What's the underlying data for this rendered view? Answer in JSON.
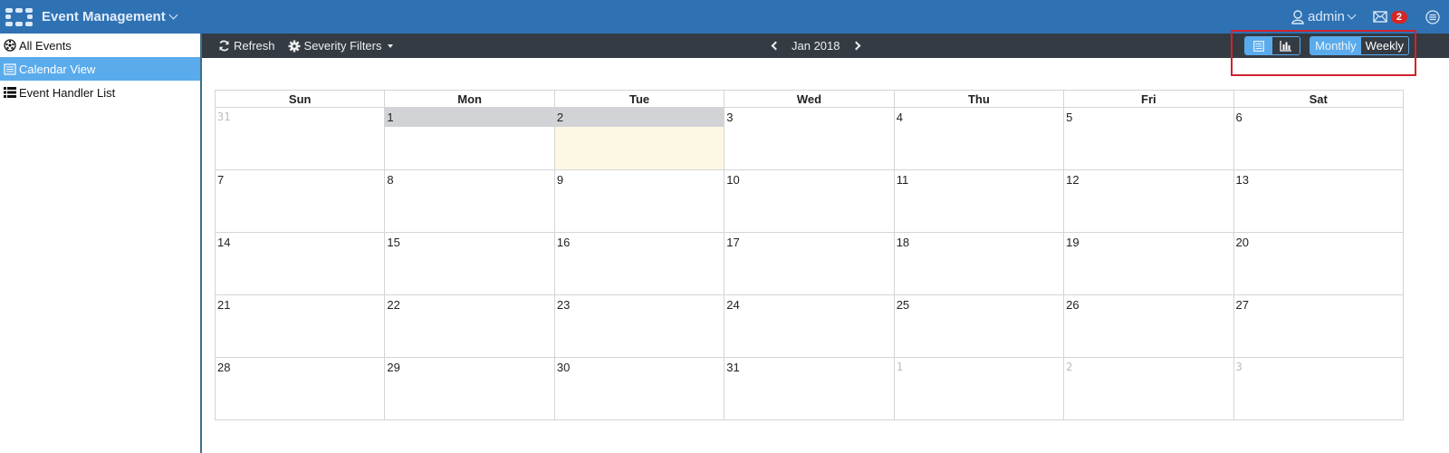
{
  "header": {
    "app_title": "Event Management",
    "user": "admin",
    "notification_count": "2",
    "icons": {
      "logo": "fortinet-grid-logo",
      "user": "user-icon",
      "mail": "mail-icon",
      "menu": "menu-icon"
    }
  },
  "sidebar": {
    "items": [
      {
        "label": "All Events",
        "icon": "dashboard-icon",
        "active": false
      },
      {
        "label": "Calendar View",
        "icon": "calendar-list-icon",
        "active": true
      },
      {
        "label": "Event Handler List",
        "icon": "list-icon",
        "active": false
      }
    ]
  },
  "toolbar": {
    "refresh_label": "Refresh",
    "severity_filters_label": "Severity Filters",
    "current_month": "Jan 2018",
    "view_type_options": [
      {
        "icon": "table-view-icon",
        "selected": true
      },
      {
        "icon": "chart-view-icon",
        "selected": false
      }
    ],
    "range_options": [
      {
        "label": "Monthly",
        "selected": true
      },
      {
        "label": "Weekly",
        "selected": false
      }
    ]
  },
  "calendar": {
    "weekdays": [
      "Sun",
      "Mon",
      "Tue",
      "Wed",
      "Thu",
      "Fri",
      "Sat"
    ],
    "weeks": [
      [
        {
          "d": "31",
          "other": true
        },
        {
          "d": "1",
          "sel": true
        },
        {
          "d": "2",
          "today": true
        },
        {
          "d": "3"
        },
        {
          "d": "4"
        },
        {
          "d": "5"
        },
        {
          "d": "6"
        }
      ],
      [
        {
          "d": "7"
        },
        {
          "d": "8"
        },
        {
          "d": "9"
        },
        {
          "d": "10"
        },
        {
          "d": "11"
        },
        {
          "d": "12"
        },
        {
          "d": "13"
        }
      ],
      [
        {
          "d": "14"
        },
        {
          "d": "15"
        },
        {
          "d": "16"
        },
        {
          "d": "17"
        },
        {
          "d": "18"
        },
        {
          "d": "19"
        },
        {
          "d": "20"
        }
      ],
      [
        {
          "d": "21"
        },
        {
          "d": "22"
        },
        {
          "d": "23"
        },
        {
          "d": "24"
        },
        {
          "d": "25"
        },
        {
          "d": "26"
        },
        {
          "d": "27"
        }
      ],
      [
        {
          "d": "28"
        },
        {
          "d": "29"
        },
        {
          "d": "30"
        },
        {
          "d": "31"
        },
        {
          "d": "1",
          "other": true
        },
        {
          "d": "2",
          "other": true
        },
        {
          "d": "3",
          "other": true
        }
      ]
    ]
  }
}
